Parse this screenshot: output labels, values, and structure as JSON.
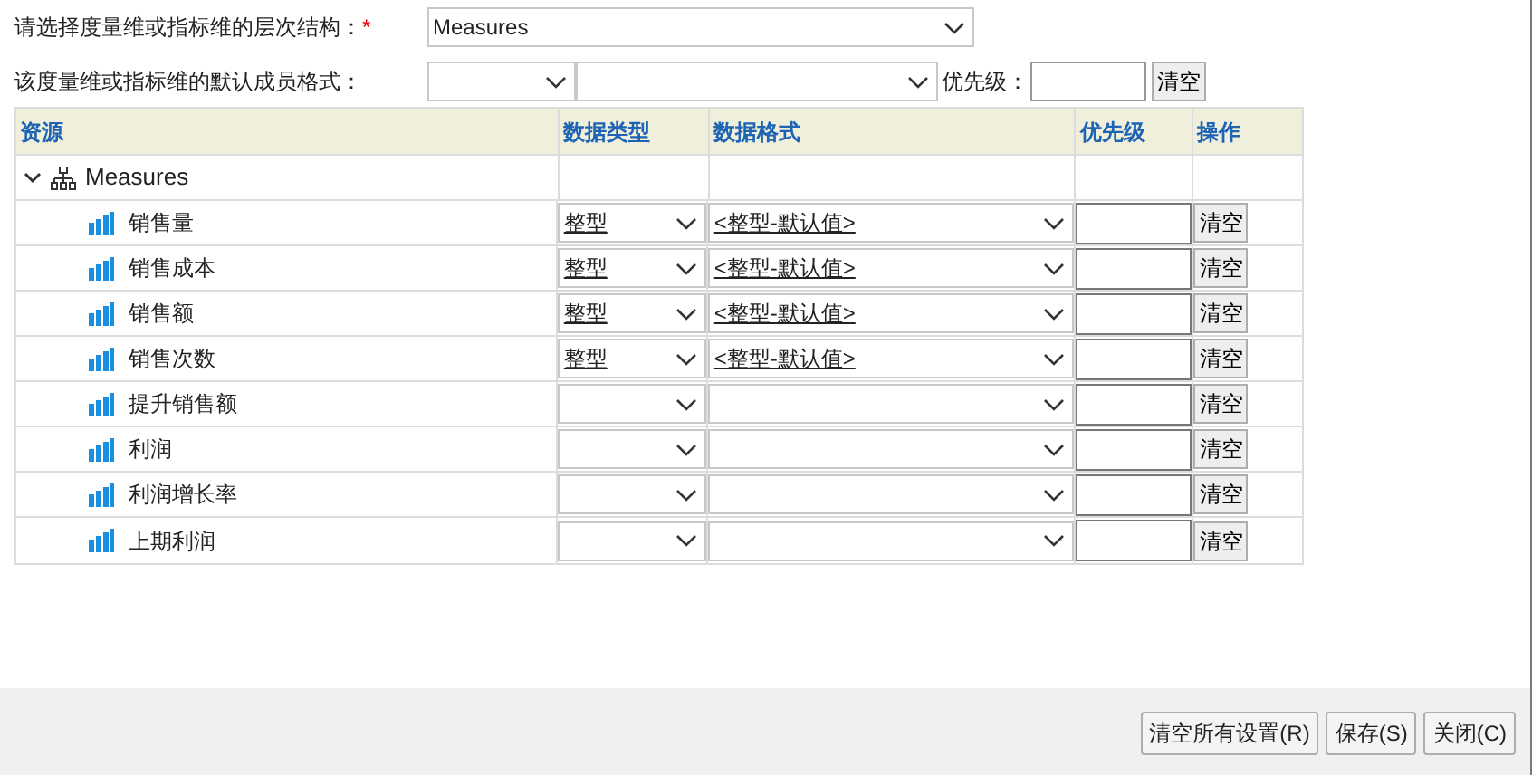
{
  "hierarchy": {
    "label": "请选择度量维或指标维的层次结构：",
    "required_mark": "*",
    "value": "Measures"
  },
  "default_format": {
    "label": "该度量维或指标维的默认成员格式：",
    "priority_label": "优先级：",
    "clear_button": "清空"
  },
  "table": {
    "columns": [
      "资源",
      "数据类型",
      "数据格式",
      "优先级",
      "操作"
    ],
    "root": {
      "name": "Measures",
      "expanded": true,
      "children": [
        {
          "name": "销售量",
          "type": "整型",
          "format": "<整型-默认值>",
          "button": "清空"
        },
        {
          "name": "销售成本",
          "type": "整型",
          "format": "<整型-默认值>",
          "button": "清空"
        },
        {
          "name": "销售额",
          "type": "整型",
          "format": "<整型-默认值>",
          "button": "清空"
        },
        {
          "name": "销售次数",
          "type": "整型",
          "format": "<整型-默认值>",
          "button": "清空"
        },
        {
          "name": "提升销售额",
          "button": "清空"
        },
        {
          "name": "利润",
          "button": "清空"
        },
        {
          "name": "利润增长率",
          "button": "清空"
        },
        {
          "name": "上期利润",
          "button": "清空"
        }
      ]
    }
  },
  "footer_buttons": [
    "清空所有设置(R)",
    "保存(S)",
    "关闭(C)"
  ]
}
